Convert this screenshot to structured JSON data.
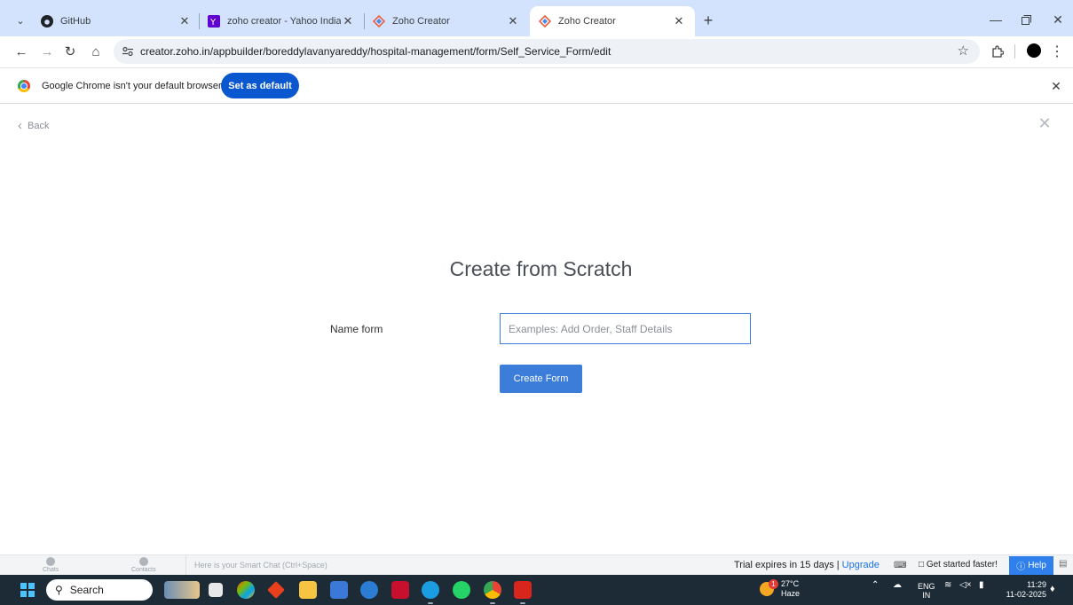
{
  "tabs": [
    {
      "title": "GitHub"
    },
    {
      "title": "zoho creator - Yahoo India Sea"
    },
    {
      "title": "Zoho Creator"
    },
    {
      "title": "Zoho Creator"
    }
  ],
  "address_bar": {
    "url": "creator.zoho.in/appbuilder/boreddylavanyareddy/hospital-management/form/Self_Service_Form/edit"
  },
  "infobar": {
    "message": "Google Chrome isn't your default browser",
    "button_label": "Set as default"
  },
  "page": {
    "back_label": "Back",
    "heading": "Create from Scratch",
    "name_label": "Name form",
    "name_placeholder": "Examples: Add Order, Staff Details",
    "name_value": "",
    "create_button_label": "Create Form"
  },
  "zoho_bar": {
    "chats_label": "Chats",
    "contacts_label": "Contacts",
    "smart_chat_placeholder": "Here is your Smart Chat (Ctrl+Space)",
    "trial_text": "Trial expires in 15 days | ",
    "upgrade_label": "Upgrade",
    "get_started_label": "Get started faster!",
    "help_label": "Help"
  },
  "taskbar": {
    "search_label": "Search",
    "weather_temp": "27°C",
    "weather_desc": "Haze",
    "weather_badge": "1",
    "language_line1": "ENG",
    "language_line2": "IN",
    "time": "11:29",
    "date": "11-02-2025"
  },
  "colors": {
    "tabstrip": "#d3e3fd",
    "primary_button": "#3b7dd8",
    "chrome_blue": "#0b57d0",
    "taskbar": "#1c2b36"
  }
}
